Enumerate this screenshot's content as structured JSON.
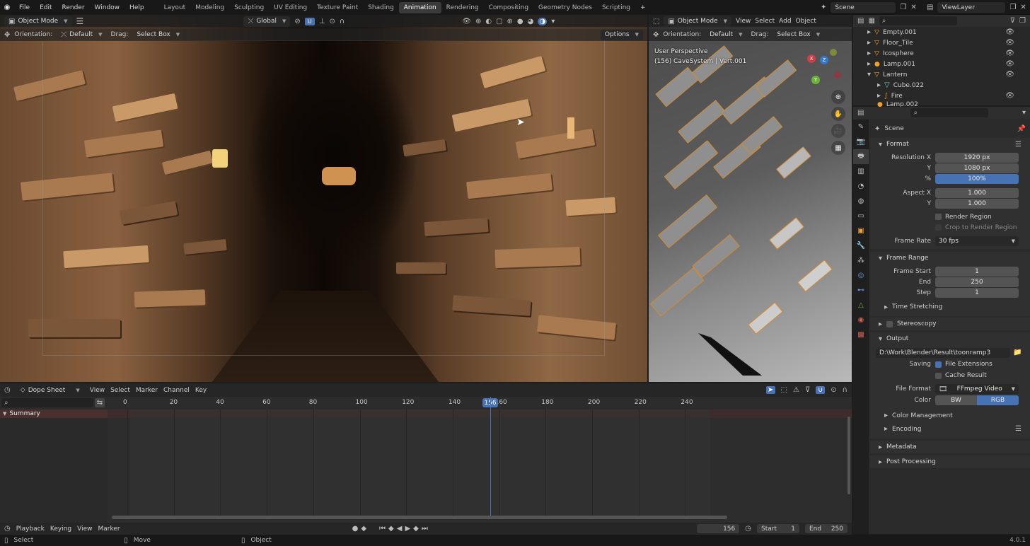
{
  "topbar": {
    "menus": [
      "File",
      "Edit",
      "Render",
      "Window",
      "Help"
    ],
    "workspaces": [
      "Layout",
      "Modeling",
      "Sculpting",
      "UV Editing",
      "Texture Paint",
      "Shading",
      "Animation",
      "Rendering",
      "Compositing",
      "Geometry Nodes",
      "Scripting"
    ],
    "active_workspace": "Animation",
    "scene": "Scene",
    "view_layer": "ViewLayer"
  },
  "viewport_left": {
    "mode": "Object Mode",
    "transform": "Global",
    "orientation_label": "Orientation:",
    "orientation": "Default",
    "drag_label": "Drag:",
    "drag": "Select Box",
    "options": "Options"
  },
  "viewport_right": {
    "mode": "Object Mode",
    "menus": [
      "View",
      "Select",
      "Add",
      "Object"
    ],
    "orientation_label": "Orientation:",
    "orientation": "Default",
    "drag_label": "Drag:",
    "drag": "Select Box",
    "perspective": "User Perspective",
    "object_info": "(156) CaveSystem | Vert.001"
  },
  "outliner": {
    "items": [
      {
        "name": "Empty.001",
        "level": 1
      },
      {
        "name": "Floor_Tile",
        "level": 1
      },
      {
        "name": "Icosphere",
        "level": 1
      },
      {
        "name": "Lamp.001",
        "level": 1
      },
      {
        "name": "Lantern",
        "level": 1
      },
      {
        "name": "Cube.022",
        "level": 2
      },
      {
        "name": "Fire",
        "level": 2
      },
      {
        "name": "Lamp.002",
        "level": 2
      }
    ]
  },
  "properties": {
    "scene_label": "Scene",
    "format": {
      "title": "Format",
      "res_x_label": "Resolution X",
      "res_x": "1920 px",
      "res_y_label": "Y",
      "res_y": "1080 px",
      "pct_label": "%",
      "pct": "100%",
      "aspect_x_label": "Aspect X",
      "aspect_x": "1.000",
      "aspect_y_label": "Y",
      "aspect_y": "1.000",
      "render_region": "Render Region",
      "crop": "Crop to Render Region",
      "frame_rate_label": "Frame Rate",
      "frame_rate": "30 fps"
    },
    "frame_range": {
      "title": "Frame Range",
      "start_label": "Frame Start",
      "start": "1",
      "end_label": "End",
      "end": "250",
      "step_label": "Step",
      "step": "1",
      "time_stretching": "Time Stretching"
    },
    "stereoscopy": "Stereoscopy",
    "output": {
      "title": "Output",
      "path": "D:\\Work\\Blender\\Result\\toonramp3",
      "saving_label": "Saving",
      "file_extensions": "File Extensions",
      "cache_result": "Cache Result",
      "file_format_label": "File Format",
      "file_format": "FFmpeg Video",
      "color_label": "Color",
      "color_bw": "BW",
      "color_rgb": "RGB",
      "color_management": "Color Management",
      "encoding": "Encoding"
    },
    "metadata": "Metadata",
    "post_processing": "Post Processing"
  },
  "dope_sheet": {
    "mode": "Dope Sheet",
    "menus": [
      "View",
      "Select",
      "Marker",
      "Channel",
      "Key"
    ],
    "ruler": [
      "0",
      "20",
      "40",
      "60",
      "80",
      "100",
      "120",
      "140",
      "160",
      "180",
      "200",
      "220",
      "240"
    ],
    "current_frame": "156",
    "summary": "Summary"
  },
  "timeline": {
    "menus": [
      "Playback",
      "Keying",
      "View",
      "Marker"
    ],
    "current_frame": "156",
    "start_label": "Start",
    "start": "1",
    "end_label": "End",
    "end": "250"
  },
  "status_bar": {
    "select": "Select",
    "move": "Move",
    "object": "Object",
    "version": "4.0.1"
  }
}
